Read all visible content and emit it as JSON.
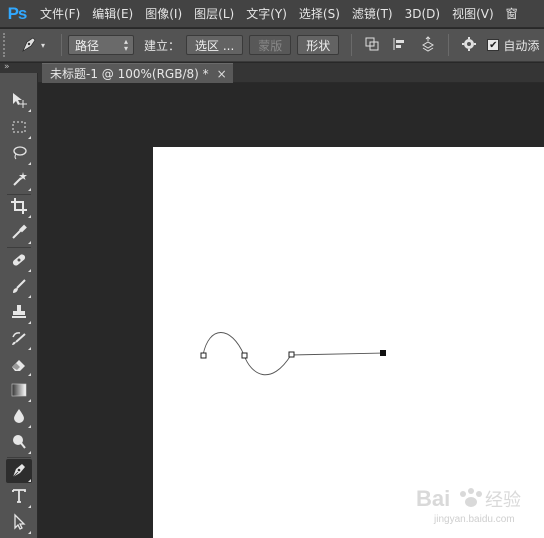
{
  "app": {
    "logo": "Ps"
  },
  "menu": [
    "文件(F)",
    "编辑(E)",
    "图像(I)",
    "图层(L)",
    "文字(Y)",
    "选择(S)",
    "滤镜(T)",
    "3D(D)",
    "视图(V)",
    "窗"
  ],
  "options": {
    "mode_select": "路径",
    "build_label": "建立：",
    "selection_button": "选区 ...",
    "mask_button": "蒙版",
    "shape_button": "形状",
    "auto_checkbox_label": "自动添",
    "auto_checked": true
  },
  "document": {
    "tab_title": "未标题-1 @ 100%(RGB/8) *",
    "close_glyph": "×"
  },
  "tools": [
    "move-tool",
    "marquee-tool",
    "lasso-tool",
    "magic-wand-tool",
    "crop-tool",
    "eyedropper-tool",
    "healing-brush-tool",
    "brush-tool",
    "clone-stamp-tool",
    "history-brush-tool",
    "eraser-tool",
    "gradient-tool",
    "blur-tool",
    "dodge-tool",
    "pen-tool",
    "type-tool",
    "path-selection-tool"
  ],
  "active_tool": "pen-tool",
  "colors": {
    "menubar": "#434343",
    "optbar": "#535353",
    "workspace": "#282828",
    "logo": "#31a8ff",
    "canvas": "#ffffff"
  },
  "watermark": {
    "brand": "Bai",
    "brand_cn": "经验",
    "url": "jingyan.baidu.com"
  }
}
